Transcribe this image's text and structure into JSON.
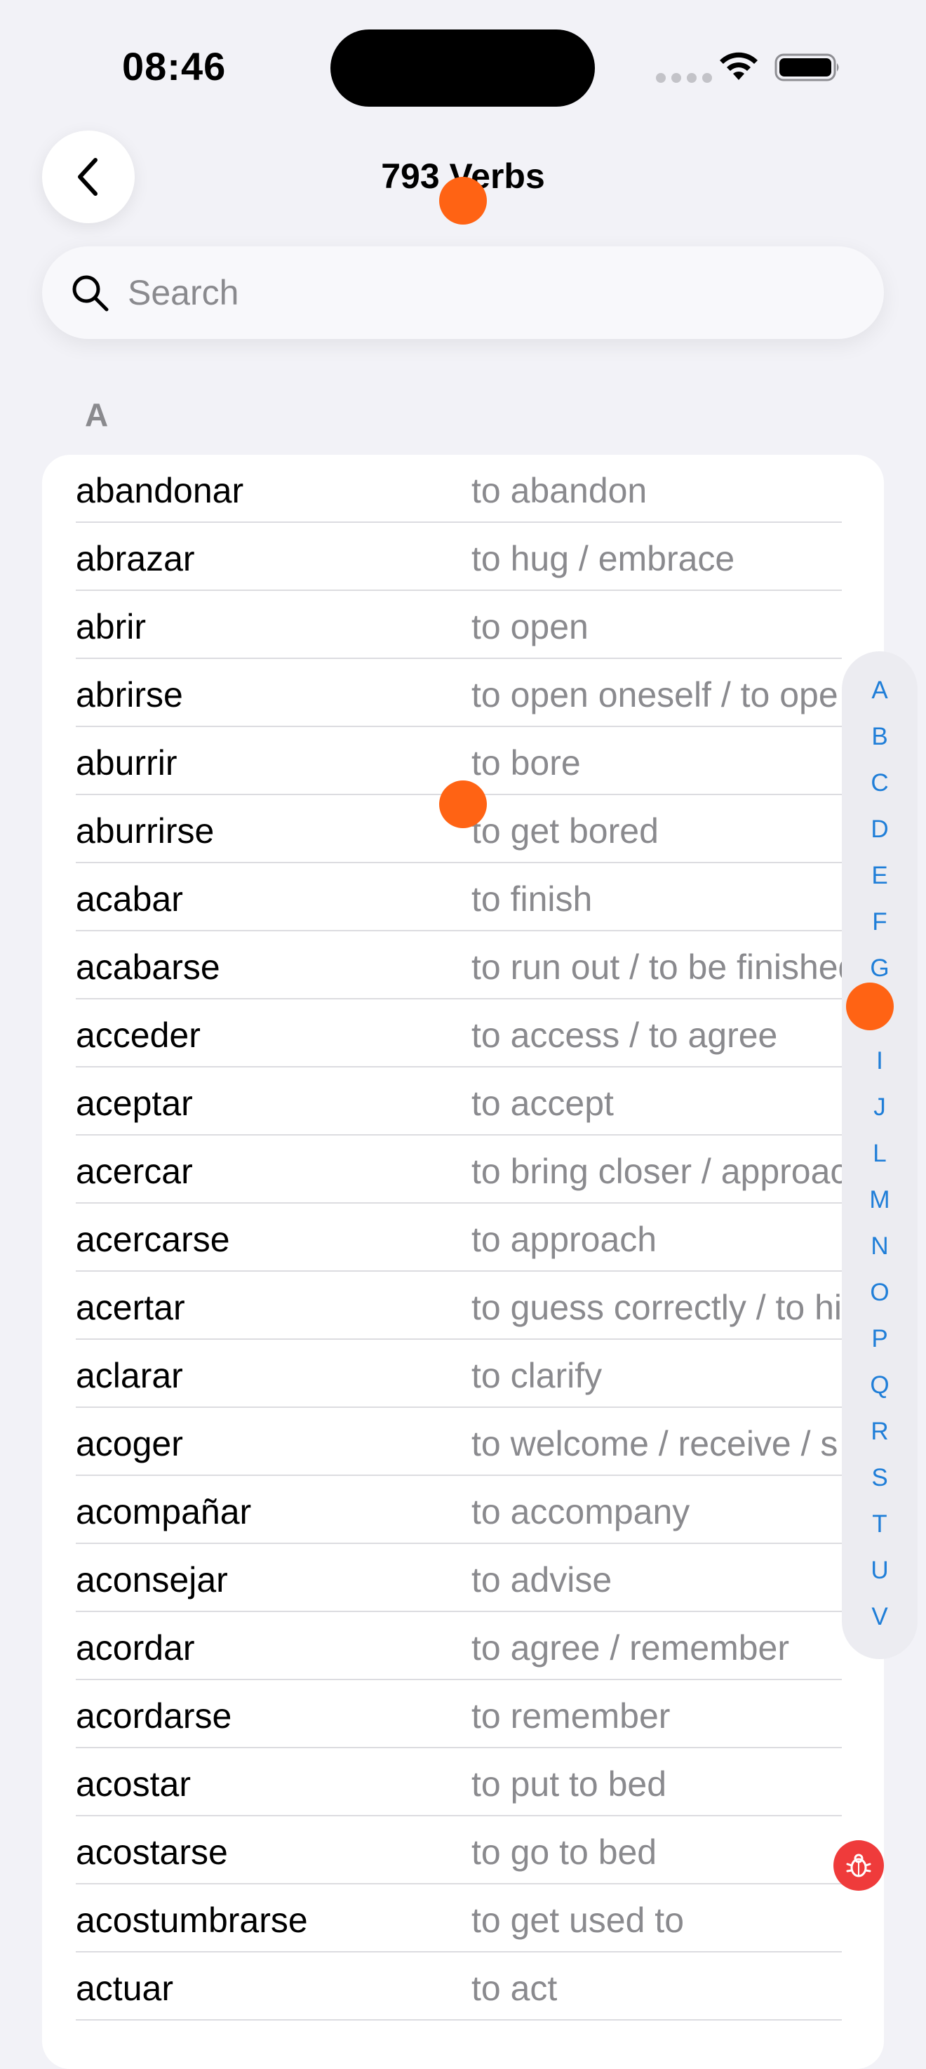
{
  "status_bar": {
    "time": "08:46"
  },
  "nav": {
    "title": "793 Verbs",
    "back_icon": "chevron-left-icon"
  },
  "search": {
    "placeholder": "Search",
    "value": "",
    "icon": "search-icon"
  },
  "section": {
    "header": "A"
  },
  "verbs": [
    {
      "spanish": "abandonar",
      "english": "to abandon"
    },
    {
      "spanish": "abrazar",
      "english": "to hug / embrace"
    },
    {
      "spanish": "abrir",
      "english": "to open"
    },
    {
      "spanish": "abrirse",
      "english": "to open oneself / to open up"
    },
    {
      "spanish": "aburrir",
      "english": "to bore"
    },
    {
      "spanish": "aburrirse",
      "english": "to get bored"
    },
    {
      "spanish": "acabar",
      "english": "to finish"
    },
    {
      "spanish": "acabarse",
      "english": "to run out / to be finished"
    },
    {
      "spanish": "acceder",
      "english": "to access / to agree"
    },
    {
      "spanish": "aceptar",
      "english": "to accept"
    },
    {
      "spanish": "acercar",
      "english": "to bring closer / approach"
    },
    {
      "spanish": "acercarse",
      "english": "to approach"
    },
    {
      "spanish": "acertar",
      "english": "to guess correctly / to hit the mark"
    },
    {
      "spanish": "aclarar",
      "english": "to clarify"
    },
    {
      "spanish": "acoger",
      "english": "to welcome / receive / shelter"
    },
    {
      "spanish": "acompañar",
      "english": "to accompany"
    },
    {
      "spanish": "aconsejar",
      "english": "to advise"
    },
    {
      "spanish": "acordar",
      "english": "to agree / remember"
    },
    {
      "spanish": "acordarse",
      "english": "to remember"
    },
    {
      "spanish": "acostar",
      "english": "to put to bed"
    },
    {
      "spanish": "acostarse",
      "english": "to go to bed"
    },
    {
      "spanish": "acostumbrarse",
      "english": "to get used to"
    },
    {
      "spanish": "actuar",
      "english": "to act"
    }
  ],
  "alphabet_index": [
    "A",
    "B",
    "C",
    "D",
    "E",
    "F",
    "G",
    "H",
    "I",
    "J",
    "L",
    "M",
    "N",
    "O",
    "P",
    "Q",
    "R",
    "S",
    "T",
    "U",
    "V"
  ],
  "colors": {
    "background": "#f2f2f7",
    "accent": "#1f7ed8",
    "secondary_text": "#8a8a8e",
    "touch_marker": "#ff6314",
    "debug_button": "#ef3b3b"
  }
}
